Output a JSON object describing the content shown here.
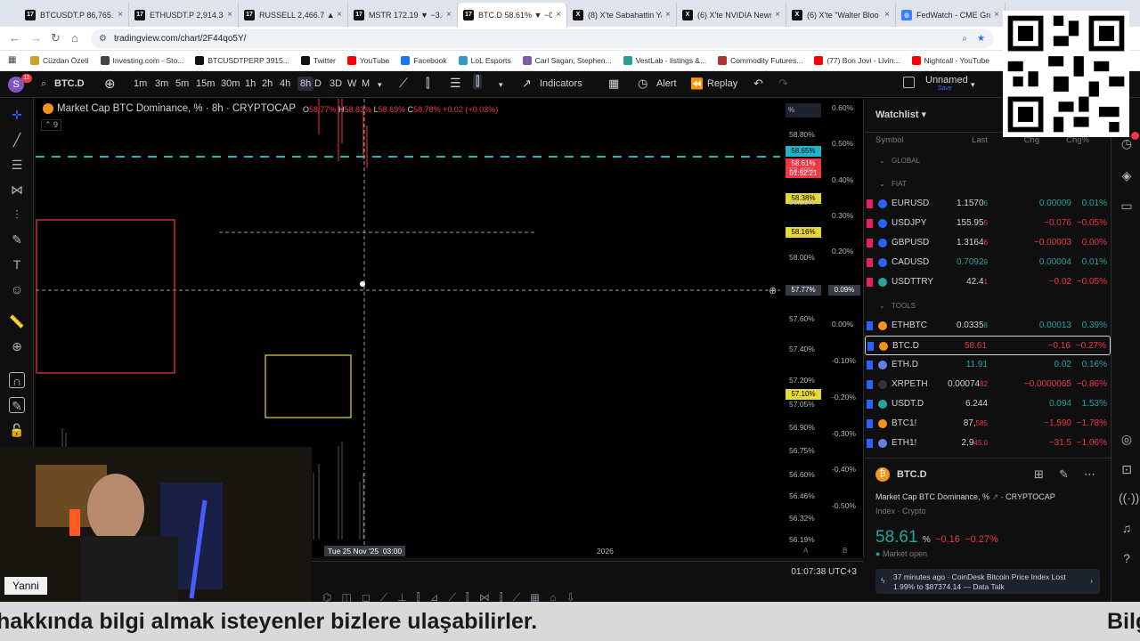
{
  "browser": {
    "tabs": [
      {
        "title": "BTCUSDT.P 86,765.9",
        "icon": "TV"
      },
      {
        "title": "ETHUSDT.P 2,914.34",
        "icon": "TV"
      },
      {
        "title": "RUSSELL 2,466.7 ▲ -",
        "icon": "TV"
      },
      {
        "title": "MSTR 172.19 ▼ −3.8",
        "icon": "TV"
      },
      {
        "title": "BTC.D 58.61% ▼ −0.2",
        "icon": "TV"
      },
      {
        "title": "(8) X'te Sabahattin Ya",
        "icon": "X"
      },
      {
        "title": "(6) X'te NVIDIA News",
        "icon": "X"
      },
      {
        "title": "(6) X'te \"Walter Bloo",
        "icon": "X"
      },
      {
        "title": "FedWatch - CME Gro",
        "icon": "globe"
      }
    ],
    "url": "tradingview.com/chart/2F44qo5Y/",
    "bookmarks": [
      {
        "label": "Cüzdan Özeti",
        "color": "#c9a227"
      },
      {
        "label": "Investing.com - Sto...",
        "color": "#444444"
      },
      {
        "label": "BTCUSDTPERP 3915...",
        "color": "#111111"
      },
      {
        "label": "Twitter",
        "color": "#111111"
      },
      {
        "label": "YouTube",
        "color": "#ff0000"
      },
      {
        "label": "Facebook",
        "color": "#1877f2"
      },
      {
        "label": "LoL Esports",
        "color": "#3399cc"
      },
      {
        "label": "Carl Sagan, Stephen...",
        "color": "#7b5ea7"
      },
      {
        "label": "VestLab - listings &...",
        "color": "#2a9d8f"
      },
      {
        "label": "Commodity Futures...",
        "color": "#aa3333"
      },
      {
        "label": "(77) Bon Jovi - Livin...",
        "color": "#ff0000"
      },
      {
        "label": "Nightcall - YouTube",
        "color": "#ff0000"
      }
    ]
  },
  "toolbar": {
    "avatar": "S",
    "avatar_badge": "11",
    "symbol": "BTC.D",
    "intervals": [
      "1m",
      "3m",
      "5m",
      "15m",
      "30m",
      "1h",
      "2h",
      "4h",
      "8h",
      "D",
      "3D",
      "W",
      "M"
    ],
    "active_interval": "8h",
    "indicators": "Indicators",
    "alert": "Alert",
    "replay": "Replay",
    "layout_name": "Unnamed",
    "layout_status": "Save"
  },
  "chart": {
    "title": "Market Cap BTC Dominance, % · 8h · CRYPTOCAP",
    "ohlc": {
      "o": "58.77%",
      "h": "58.83%",
      "l": "58.69%",
      "c": "58.78%",
      "chg": "+0.02 (+0.03%)"
    },
    "indicator_count": "9",
    "price_labels": [
      "58.80%",
      "58.60%",
      "58.40%",
      "58.20%",
      "58.00%",
      "57.80%",
      "57.60%",
      "57.40%",
      "57.20%",
      "57.05%",
      "56.90%",
      "56.75%",
      "56.60%",
      "56.46%",
      "56.32%",
      "56.19%"
    ],
    "pct_labels": [
      "0.60%",
      "0.50%",
      "0.40%",
      "0.30%",
      "0.20%",
      "0.09%",
      "0.00%",
      "-0.10%",
      "-0.20%",
      "-0.30%",
      "-0.40%",
      "-0.50%"
    ],
    "current_price": "58.61%",
    "countdown": "01:52:21",
    "hline_price": "58.65%",
    "yellow_price_1": "58.38%",
    "yellow_price_2": "58.16%",
    "yellow_price_3": "57.10%",
    "cursor_price": "57.77%",
    "cursor_pct": "0.09%",
    "scale_mode": "%",
    "time_cursor": "Tue 25 Nov '25",
    "time_cursor_2": "03:00",
    "time_label_2026": "2026",
    "clock": "01:07:38 UTC+3",
    "auto_label": "A",
    "bar_label": "B"
  },
  "watchlist": {
    "title": "Watchlist",
    "headers": {
      "symbol": "Symbol",
      "last": "Last",
      "chg": "Chg",
      "chgp": "Chg%"
    },
    "groups": {
      "global": "GLOBAL",
      "fiat": "FIAT",
      "tools": "TOOLS"
    },
    "fiat": [
      {
        "symbol": "EURUSD",
        "last": "1.1570",
        "last_sup": "6",
        "chg": "0.00009",
        "chgp": "0.01%",
        "dir": "pos",
        "color": "#2962ff",
        "flag": "#e91e63"
      },
      {
        "symbol": "USDJPY",
        "last": "155.95",
        "last_sup": "5",
        "chg": "−0.076",
        "chgp": "−0.05%",
        "dir": "neg",
        "color": "#2962ff",
        "flag": "#e91e63"
      },
      {
        "symbol": "GBPUSD",
        "last": "1.3164",
        "last_sup": "6",
        "chg": "−0.00003",
        "chgp": "0.00%",
        "dir": "neg",
        "color": "#2962ff",
        "flag": "#e91e63"
      },
      {
        "symbol": "CADUSD",
        "last": "0.7092",
        "last_sup": "9",
        "chg": "0.00004",
        "chgp": "0.01%",
        "dir": "pos",
        "color": "#2962ff",
        "flag": "#e91e63"
      },
      {
        "symbol": "USDTTRY",
        "last": "42.4",
        "last_sup": "1",
        "chg": "−0.02",
        "chgp": "−0.05%",
        "dir": "neg",
        "color": "#26a69a",
        "flag": "#e91e63"
      }
    ],
    "tools": [
      {
        "symbol": "ETHBTC",
        "last": "0.0335",
        "last_sup": "8",
        "chg": "0.00013",
        "chgp": "0.39%",
        "dir": "pos",
        "color": "#f7931a",
        "flag": "#2962ff"
      },
      {
        "symbol": "BTC.D",
        "last": "58.61",
        "last_sup": "",
        "chg": "−0.16",
        "chgp": "−0.27%",
        "dir": "neg",
        "color": "#f7931a",
        "flag": "#2962ff"
      },
      {
        "symbol": "ETH.D",
        "last": "11.91",
        "last_sup": "",
        "chg": "0.02",
        "chgp": "0.16%",
        "dir": "pos",
        "color": "#627eea",
        "flag": "#2962ff"
      },
      {
        "symbol": "XRPETH",
        "last": "0.00074",
        "last_sup": "82",
        "chg": "−0.0000065",
        "chgp": "−0.86%",
        "dir": "neg",
        "color": "#333333",
        "flag": "#2962ff"
      },
      {
        "symbol": "USDT.D",
        "last": "6.244",
        "last_sup": "",
        "chg": "0.094",
        "chgp": "1.53%",
        "dir": "pos",
        "color": "#26a69a",
        "flag": "#2962ff"
      },
      {
        "symbol": "BTC1!",
        "last": "87,",
        "last_sup": "585",
        "chg": "−1,590",
        "chgp": "−1.78%",
        "dir": "neg",
        "color": "#f7931a",
        "flag": "#2962ff"
      },
      {
        "symbol": "ETH1!",
        "last": "2,9",
        "last_sup": "45.0",
        "chg": "−31.5",
        "chgp": "−1.06%",
        "dir": "neg",
        "color": "#627eea",
        "flag": "#2962ff"
      }
    ]
  },
  "details": {
    "symbol": "BTC.D",
    "name": "Market Cap BTC Dominance, %",
    "exchange": "CRYPTOCAP",
    "type": "Index · Crypto",
    "price": "58.61",
    "unit": "%",
    "chg": "−0.16",
    "chgp": "−0.27%",
    "status": "Market open",
    "news_time": "37 minutes ago · CoinDesk Bitcoin Price Index Lost 1.99% to $87374.14 — Data Talk"
  },
  "webcam": {
    "name": "Yanni"
  },
  "subtitle": {
    "text": "hakkında bilgi almak isteyenler bizlere ulaşabilirler.",
    "right": "Bilg"
  }
}
